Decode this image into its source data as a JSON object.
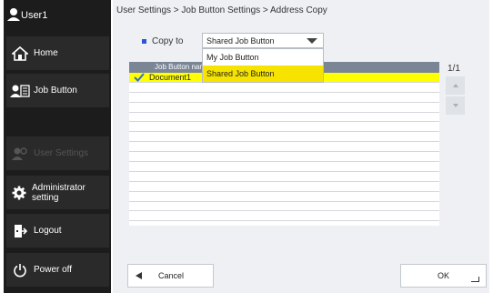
{
  "sidebar": {
    "user": {
      "label": "User1",
      "icon": "user-icon"
    },
    "items": [
      {
        "label": "Home",
        "icon": "home-icon",
        "disabled": false
      },
      {
        "label": "Job Button",
        "icon": "job-button-icon",
        "disabled": false
      },
      {
        "label": "User Settings",
        "icon": "user-settings-icon",
        "disabled": true
      },
      {
        "label": "Administrator setting",
        "icon": "gear-icon",
        "disabled": false
      },
      {
        "label": "Logout",
        "icon": "logout-icon",
        "disabled": false
      },
      {
        "label": "Power off",
        "icon": "power-icon",
        "disabled": false
      }
    ]
  },
  "main": {
    "breadcrumb": "User Settings > Job Button Settings > Address Copy",
    "copy_to": {
      "label": "Copy to",
      "selected": "Shared Job Button",
      "options": [
        "My Job Button",
        "Shared Job Button"
      ],
      "selected_index": 1
    },
    "list": {
      "header": "Job Button name",
      "rows": [
        {
          "label": "Document1",
          "checked": true
        }
      ],
      "page": "1/1"
    },
    "buttons": {
      "cancel": "Cancel",
      "ok": "OK"
    }
  },
  "colors": {
    "sidebar_bg": "#1c1c1c",
    "selected_row": "#ffff00",
    "dropdown_highlight": "#f6e400",
    "list_header": "#7a8596"
  }
}
